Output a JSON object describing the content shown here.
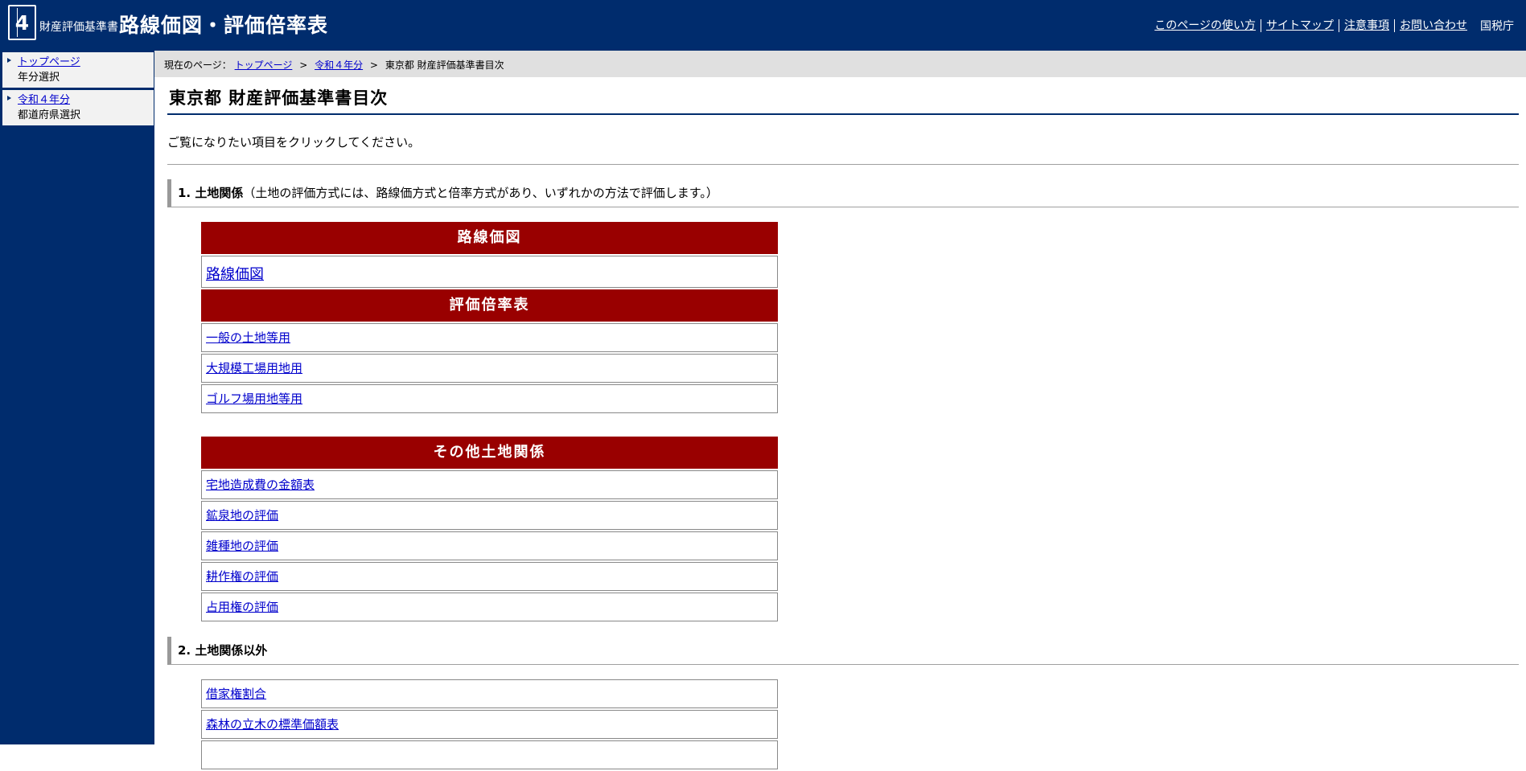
{
  "header": {
    "logo_number": "4",
    "site_sub": "財産評価基準書",
    "site_main": "路線価図・評価倍率表",
    "nav": [
      "このページの使い方",
      "サイトマップ",
      "注意事項",
      "お問い合わせ"
    ],
    "agency": "国税庁"
  },
  "sidebar": {
    "items": [
      {
        "link": "トップページ",
        "sub": "年分選択"
      },
      {
        "link": "令和４年分",
        "sub": "都道府県選択"
      }
    ]
  },
  "breadcrumb": {
    "label": "現在のページ：",
    "links": [
      "トップページ",
      "令和４年分"
    ],
    "current": "東京都 財産評価基準書目次",
    "sep": ">"
  },
  "main": {
    "title": "東京都 財産評価基準書目次",
    "intro": "ご覧になりたい項目をクリックしてください。",
    "section1": {
      "title": "1. 土地関係",
      "note": "（土地の評価方式には、路線価方式と倍率方式があり、いずれかの方法で評価します。）"
    },
    "rosenka": {
      "header": "路線価図",
      "links": [
        "路線価図"
      ]
    },
    "bairitsu": {
      "header": "評価倍率表",
      "links": [
        "一般の土地等用",
        "大規模工場用地用",
        "ゴルフ場用地等用"
      ]
    },
    "other_land": {
      "header": "その他土地関係",
      "links": [
        "宅地造成費の金額表",
        "鉱泉地の評価",
        "雑種地の評価",
        "耕作権の評価",
        "占用権の評価"
      ]
    },
    "section2": {
      "title": "2. 土地関係以外"
    },
    "non_land": {
      "links": [
        "借家権割合",
        "森林の立木の標準価額表"
      ]
    }
  }
}
